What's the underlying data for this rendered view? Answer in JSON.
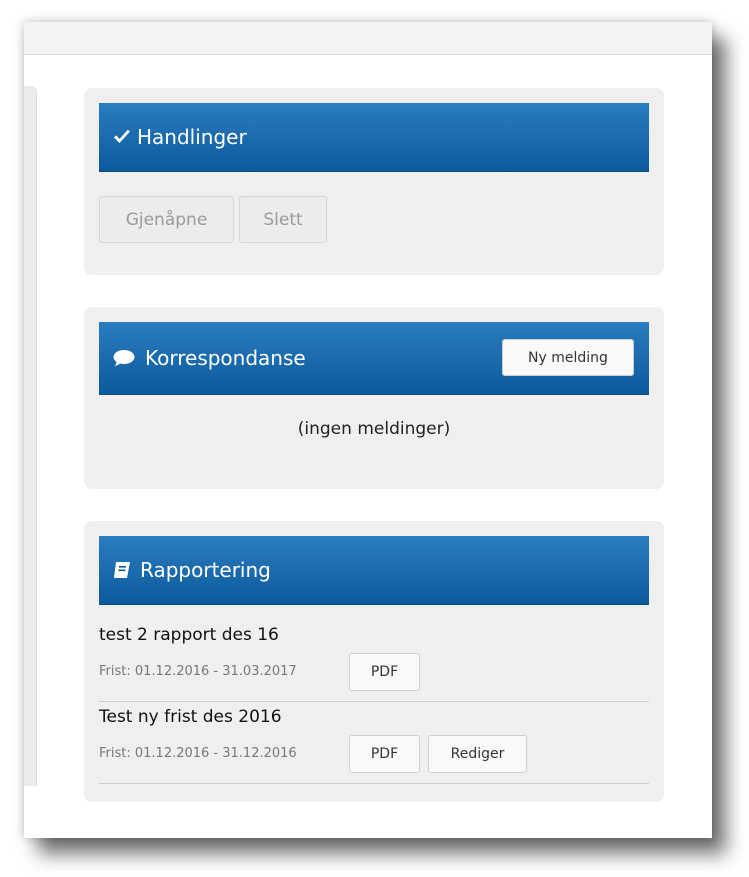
{
  "handlinger": {
    "title": "Handlinger",
    "buttons": [
      "Gjenåpne",
      "Slett"
    ]
  },
  "korrespondanse": {
    "title": "Korrespondanse",
    "new_message_label": "Ny melding",
    "empty_text": "(ingen meldinger)"
  },
  "rapportering": {
    "title": "Rapportering",
    "reports": [
      {
        "title": "test 2 rapport des 16",
        "frist": "Frist: 01.12.2016 - 31.03.2017",
        "pdf_label": "PDF"
      },
      {
        "title": "Test ny frist des 2016",
        "frist": "Frist: 01.12.2016 - 31.12.2016",
        "pdf_label": "PDF",
        "edit_label": "Rediger"
      }
    ]
  },
  "colors": {
    "header_top": "#2b7cc0",
    "header_bottom": "#0b5a9b",
    "panel_bg": "#efefef"
  },
  "icons": {
    "handlinger": "check-icon",
    "korrespondanse": "comment-icon",
    "rapportering": "book-icon"
  }
}
